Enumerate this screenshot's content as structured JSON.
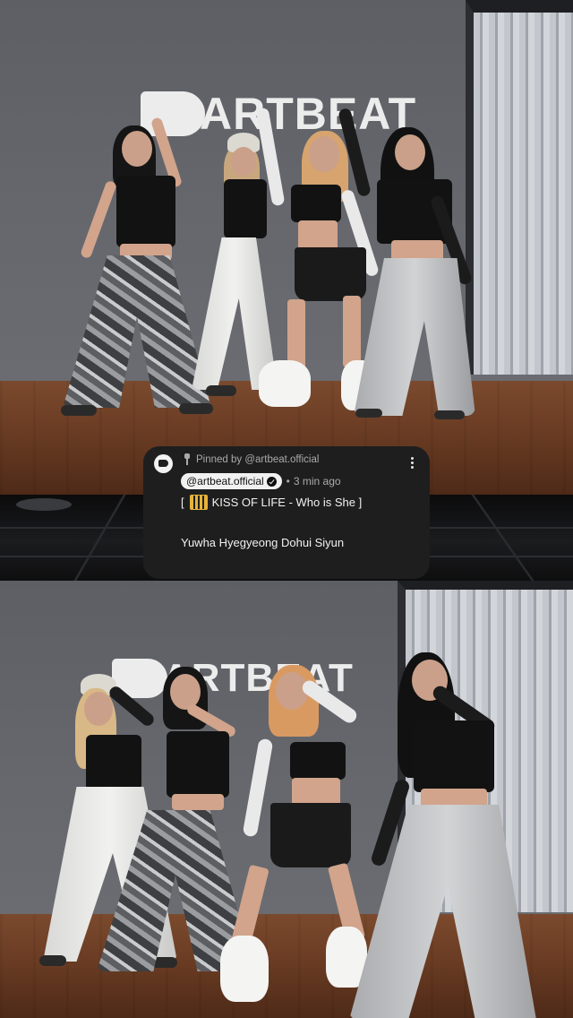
{
  "video": {
    "top_logo_text": "ARTBEAT",
    "bottom_logo_text": "ARTBEAT"
  },
  "pinned_comment": {
    "pinned_by": "Pinned by @artbeat.official",
    "author": "@artbeat.official",
    "time_ago": "3 min ago",
    "separator": "•",
    "bracket_open": "[",
    "song_title": "KISS OF LIFE - Who is She ]",
    "members": "Yuwha Hyegyeong Dohui Siyun",
    "icons": {
      "avatar": "artbeat-logo-avatar",
      "pin": "pin-icon",
      "verified": "verified-check-icon",
      "menu": "more-vertical-icon",
      "emoji": "song-emoji-icon"
    }
  },
  "colors": {
    "comment_bg": "#1e1e1e",
    "chip_bg": "#f1f1f1",
    "muted_text": "#aaaaaa"
  }
}
